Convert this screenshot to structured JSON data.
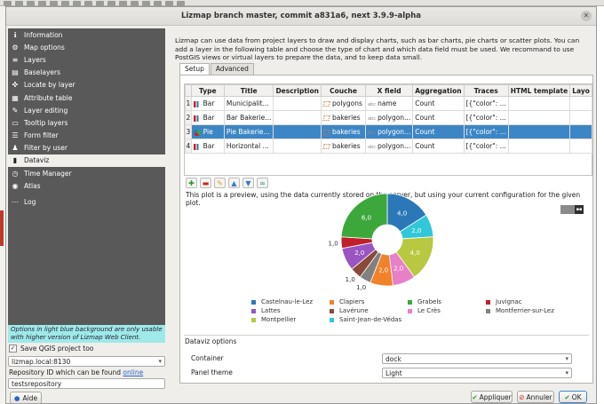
{
  "window": {
    "title": "Lizmap branch master, commit a831a6, next 3.9.9-alpha"
  },
  "sidebar": {
    "items": [
      {
        "label": "Information",
        "icon": "info-icon"
      },
      {
        "label": "Map options",
        "icon": "gear-icon"
      },
      {
        "label": "Layers",
        "icon": "layers-icon"
      },
      {
        "label": "Baselayers",
        "icon": "baselayers-icon"
      },
      {
        "label": "Locate by layer",
        "icon": "locate-icon"
      },
      {
        "label": "Attribute table",
        "icon": "table-icon"
      },
      {
        "label": "Layer editing",
        "icon": "edit-icon"
      },
      {
        "label": "Tooltip layers",
        "icon": "tooltip-icon"
      },
      {
        "label": "Form filter",
        "icon": "form-icon"
      },
      {
        "label": "Filter by user",
        "icon": "user-icon"
      },
      {
        "label": "Dataviz",
        "icon": "chart-icon"
      },
      {
        "label": "Time Manager",
        "icon": "clock-icon"
      },
      {
        "label": "Atlas",
        "icon": "atlas-icon"
      },
      {
        "label": "Log",
        "icon": "log-icon"
      }
    ],
    "active_index": 10,
    "info_text": "Options in light blue background are only usable with higher version of Lizmap Web Client.",
    "save_project_label": "Save QGIS project too",
    "server_value": "lizmap.local:8130",
    "repo_label": "Repository ID which can be found",
    "repo_link": "online",
    "repo_value": "testsrepository",
    "help_label": "Aide"
  },
  "main": {
    "intro": "Lizmap can use data from project layers to draw and display charts, such as bar charts, pie charts or scatter plots. You can add a layer in the following table and choose the type of chart and which data field must be used. We recommand to use PostGIS views or virtual layers to prepare the data, and to keep data small.",
    "tabs": [
      "Setup",
      "Advanced"
    ],
    "active_tab": 0,
    "table": {
      "headers": [
        "Type",
        "Title",
        "Description",
        "Couche",
        "X field",
        "Aggregation",
        "Traces",
        "HTML template",
        "Layo"
      ],
      "rows": [
        {
          "num": "1",
          "type": "Bar",
          "title": "Municipalit...",
          "description": "",
          "couche": "polygons",
          "xfield": "name",
          "aggregation": "Count",
          "traces": "[{\"color\": ...",
          "html": "",
          "layout": ""
        },
        {
          "num": "2",
          "type": "Bar",
          "title": "Bar Bakerie...",
          "description": "",
          "couche": "bakeries",
          "xfield": "polygon...",
          "aggregation": "Count",
          "traces": "[{\"color\": ...",
          "html": "",
          "layout": ""
        },
        {
          "num": "3",
          "type": "Pie",
          "title": "Pie Bakerie...",
          "description": "",
          "couche": "bakeries",
          "xfield": "polygon...",
          "aggregation": "Count",
          "traces": "[{\"color\": ...",
          "html": "",
          "layout": ""
        },
        {
          "num": "4",
          "type": "Bar",
          "title": "Horizontal ...",
          "description": "",
          "couche": "bakeries",
          "xfield": "polygon...",
          "aggregation": "Count",
          "traces": "[{\"color\": ...",
          "html": "",
          "layout": ""
        }
      ],
      "selected_index": 2
    },
    "preview_note": "This plot is a preview, using the data currently stored on the server, but using your current configuration for the given plot.",
    "dataviz_options_title": "Dataviz options",
    "container_label": "Container",
    "container_value": "dock",
    "panel_theme_label": "Panel theme",
    "panel_theme_value": "Light"
  },
  "chart_data": {
    "type": "pie",
    "donut": true,
    "categories": [
      "Castelnau-le-Lez",
      "Clapiers",
      "Grabels",
      "Juvignac",
      "Lattes",
      "Lavérune",
      "Le Crès",
      "Montferrier-sur-Lez",
      "Montpellier",
      "Saint-Jean-de-Védas"
    ],
    "values": [
      4,
      2,
      6,
      1,
      2,
      1,
      2,
      1,
      4,
      2
    ],
    "value_labels": [
      "4,0",
      "2,0",
      "6,0",
      "1,0",
      "2,0",
      "1,0",
      "2,0",
      "1,0",
      "4,0",
      "2,0"
    ],
    "colors": [
      "#2a78b8",
      "#f0822a",
      "#3ca83c",
      "#c0202a",
      "#9a55c0",
      "#8a4a3a",
      "#e880c8",
      "#808080",
      "#b8c840",
      "#30c8d8"
    ],
    "slice_order": [
      0,
      9,
      8,
      6,
      1,
      7,
      5,
      4,
      3,
      2
    ],
    "legend_position": "bottom"
  },
  "footer": {
    "apply_label": "Appliquer",
    "cancel_label": "Annuler",
    "ok_label": "OK"
  }
}
